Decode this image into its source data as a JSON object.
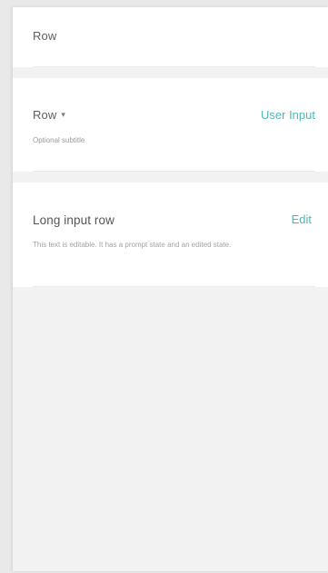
{
  "rows": {
    "row1": {
      "title": "Row"
    },
    "row2": {
      "title": "Row",
      "chevron": "▾",
      "subtitle": "Optional subtitle",
      "action": "User Input"
    },
    "row3": {
      "title": "Long input row",
      "description": "This text is editable. It has a prompt state and an edited state.",
      "action": "Edit"
    }
  },
  "colors": {
    "accent": "#4fb7b6",
    "panel_bg": "#f2f2f2",
    "section_bg": "#ffffff"
  }
}
